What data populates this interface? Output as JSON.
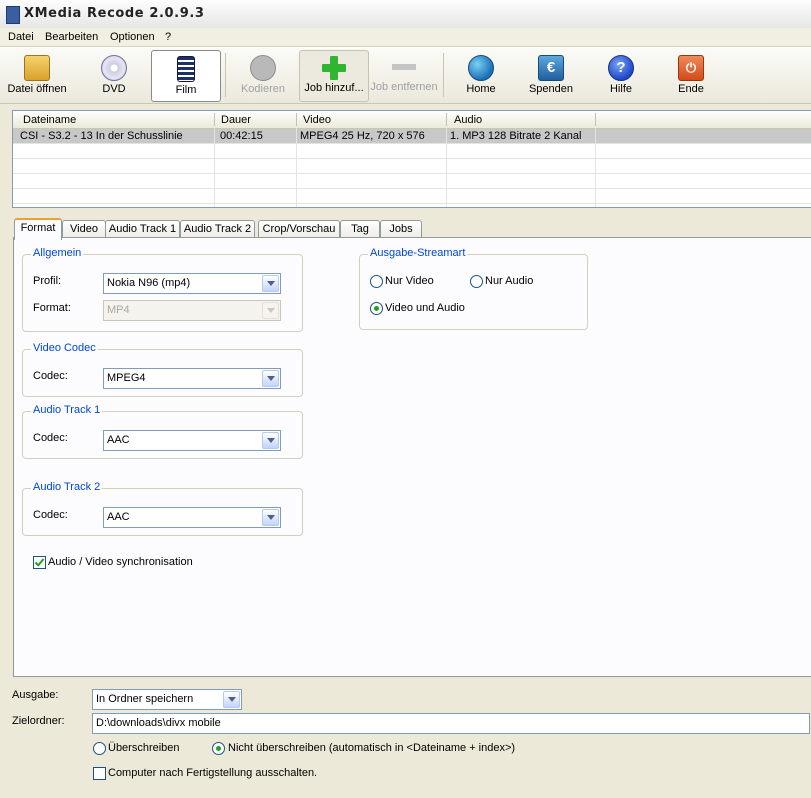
{
  "window": {
    "title": "XMedia Recode 2.0.9.3"
  },
  "menu": [
    "Datei",
    "Bearbeiten",
    "Optionen",
    "?"
  ],
  "toolbar": {
    "open": "Datei öffnen",
    "dvd": "DVD",
    "film": "Film",
    "encode": "Kodieren",
    "add_job": "Job hinzuf...",
    "remove_job": "Job entfernen",
    "home": "Home",
    "donate": "Spenden",
    "help": "Hilfe",
    "exit": "Ende"
  },
  "file_list": {
    "columns": [
      "Dateiname",
      "Dauer",
      "Video",
      "Audio"
    ],
    "rows": [
      {
        "name": "CSI - S3.2 - 13 In der Schusslinie",
        "duration": "00:42:15",
        "video": "MPEG4 25 Hz, 720 x 576",
        "audio": "1. MP3 128 Bitrate 2 Kanal"
      }
    ]
  },
  "tabs": [
    "Format",
    "Video",
    "Audio Track 1",
    "Audio Track 2",
    "Crop/Vorschau",
    "Tag",
    "Jobs"
  ],
  "format_tab": {
    "general": {
      "legend": "Allgemein",
      "profile_label": "Profil:",
      "profile_value": "Nokia N96 (mp4)",
      "format_label": "Format:",
      "format_value": "MP4"
    },
    "video_codec": {
      "legend": "Video Codec",
      "codec_label": "Codec:",
      "codec_value": "MPEG4"
    },
    "audio1": {
      "legend": "Audio Track 1",
      "codec_label": "Codec:",
      "codec_value": "AAC"
    },
    "audio2": {
      "legend": "Audio Track 2",
      "codec_label": "Codec:",
      "codec_value": "AAC"
    },
    "stream": {
      "legend": "Ausgabe-Streamart",
      "video_only": "Nur Video",
      "audio_only": "Nur Audio",
      "video_audio": "Video und Audio",
      "selected": "Video und Audio"
    },
    "sync": {
      "label": "Audio / Video synchronisation",
      "checked": true
    }
  },
  "output": {
    "label": "Ausgabe:",
    "value": "In Ordner speichern",
    "folder_label": "Zielordner:",
    "folder_value": "D:\\downloads\\divx mobile",
    "overwrite": "Überschreiben",
    "no_overwrite": "Nicht überschreiben (automatisch in <Dateiname + index>)",
    "overwrite_selected": "Nicht überschreiben",
    "shutdown": "Computer nach Fertigstellung ausschalten.",
    "shutdown_checked": false
  },
  "colors": {
    "accent": "#0046d5",
    "tab_highlight": "#f0a030",
    "check_green": "#21a121"
  }
}
